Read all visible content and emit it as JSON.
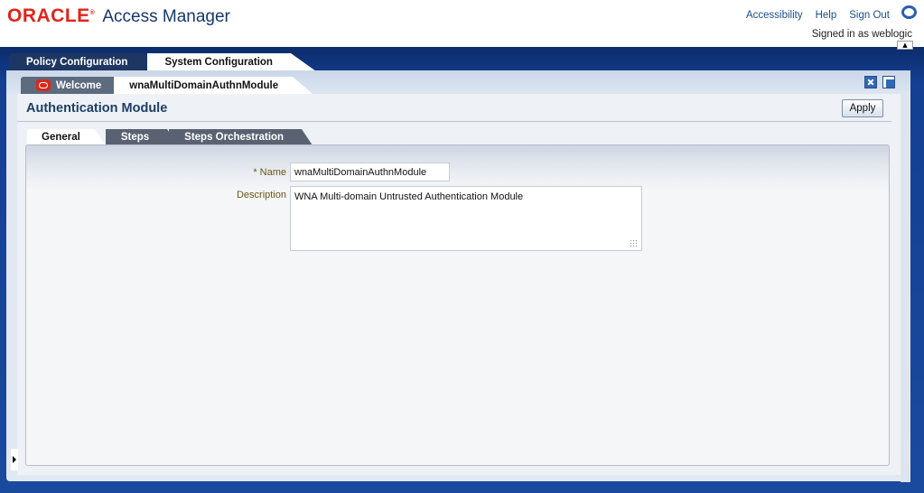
{
  "header": {
    "logo_text": "ORACLE",
    "app_title": "Access Manager",
    "links": [
      "Accessibility",
      "Help",
      "Sign Out"
    ],
    "signed_in": "Signed in as weblogic"
  },
  "main_tabs": [
    {
      "label": "Policy Configuration",
      "active": false
    },
    {
      "label": "System Configuration",
      "active": true
    }
  ],
  "doc_tabs": [
    {
      "label": "Welcome",
      "active": false
    },
    {
      "label": "wnaMultiDomainAuthnModule",
      "active": true
    }
  ],
  "page": {
    "title": "Authentication Module",
    "apply_label": "Apply"
  },
  "sub_tabs": [
    {
      "label": "General",
      "active": true
    },
    {
      "label": "Steps",
      "active": false
    },
    {
      "label": "Steps Orchestration",
      "active": false
    }
  ],
  "form": {
    "name_label": "* Name",
    "name_value": "wnaMultiDomainAuthnModule",
    "description_label": "Description",
    "description_value": "WNA Multi-domain Untrusted Authentication Module"
  },
  "icons": {
    "help": "help-icon",
    "close_all": "close-all-tabs-icon",
    "close_others": "close-other-tabs-icon",
    "splitter": "expand-arrow-icon"
  },
  "colors": {
    "oracle_red": "#e2231a",
    "title_blue": "#17386b",
    "band_blue": "#1a4a9e",
    "label_brown": "#6b5414"
  }
}
